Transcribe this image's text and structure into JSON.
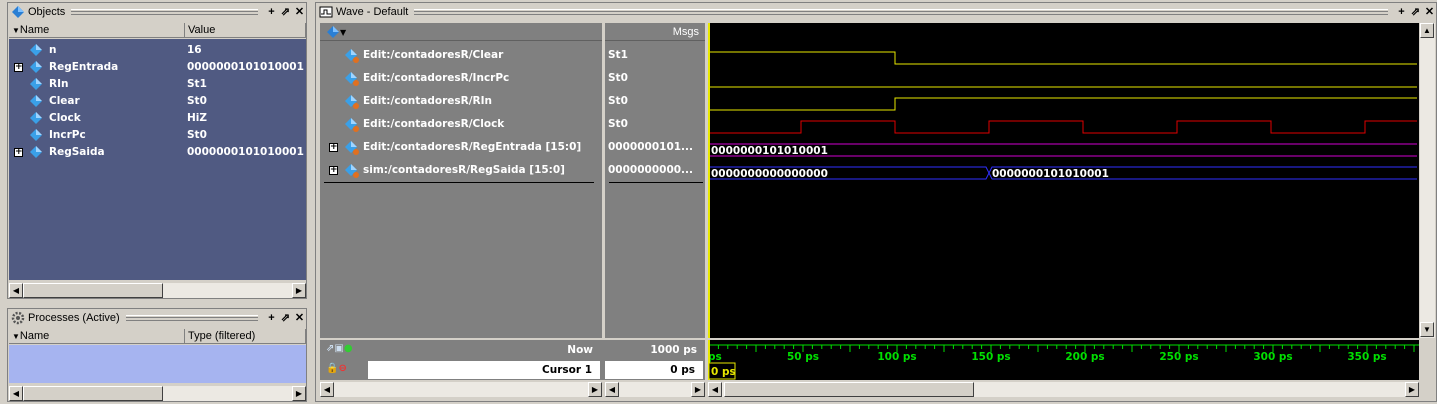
{
  "objects": {
    "title": "Objects",
    "col_name": "Name",
    "col_value": "Value",
    "rows": [
      {
        "name": "n",
        "value": "16",
        "expandable": false
      },
      {
        "name": "RegEntrada",
        "value": "0000000101010001",
        "expandable": true
      },
      {
        "name": "RIn",
        "value": "St1",
        "expandable": false
      },
      {
        "name": "Clear",
        "value": "St0",
        "expandable": false
      },
      {
        "name": "Clock",
        "value": "HiZ",
        "expandable": false
      },
      {
        "name": "IncrPc",
        "value": "St0",
        "expandable": false
      },
      {
        "name": "RegSaida",
        "value": "0000000101010001",
        "expandable": true
      }
    ]
  },
  "processes": {
    "title": "Processes (Active)",
    "col_name": "Name",
    "col_type": "Type (filtered)"
  },
  "wave": {
    "title": "Wave - Default",
    "msgs_header": "Msgs",
    "signals": [
      {
        "name": "Edit:/contadoresR/Clear",
        "value": "St1"
      },
      {
        "name": "Edit:/contadoresR/IncrPc",
        "value": "St0"
      },
      {
        "name": "Edit:/contadoresR/RIn",
        "value": "St0"
      },
      {
        "name": "Edit:/contadoresR/Clock",
        "value": "St0"
      },
      {
        "name": "Edit:/contadoresR/RegEntrada [15:0]",
        "value": "0000000101..."
      },
      {
        "name": "sim:/contadoresR/RegSaida [15:0]",
        "value": "0000000000..."
      }
    ],
    "bus_labels": {
      "regentrada_0": "0000000101010001",
      "regsaida_0": "0000000000000000",
      "regsaida_1": "0000000101010001"
    },
    "now_label": "Now",
    "now_value": "1000 ps",
    "cursor_label": "Cursor 1",
    "cursor_value": "0 ps",
    "cursor_tag": "0 ps",
    "timeline": [
      "ps",
      "50 ps",
      "100 ps",
      "150 ps",
      "200 ps",
      "250 ps",
      "300 ps",
      "350 ps"
    ],
    "colors": {
      "logic": "#e8e800",
      "clock": "#e00000",
      "bus_in": "#d000d0",
      "bus_out": "#3030ff",
      "timeline": "#00e000",
      "cursor": "#e8e800"
    }
  }
}
